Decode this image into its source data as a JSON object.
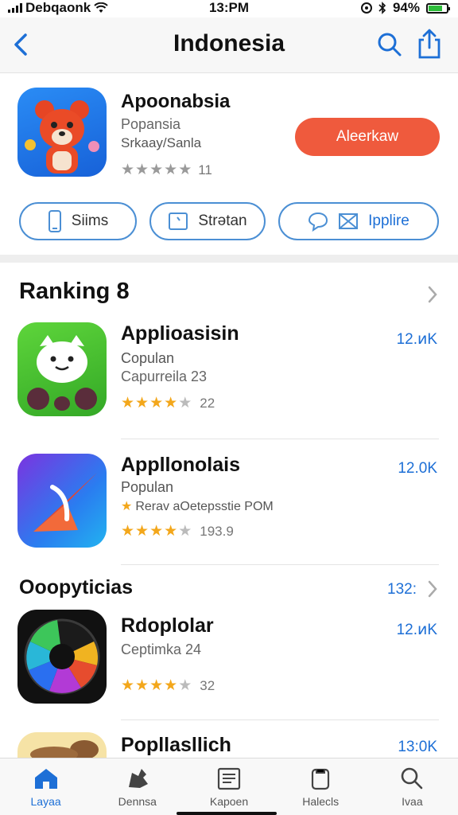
{
  "status_bar": {
    "carrier": "Debqaonk",
    "time": "13:PM",
    "battery": "94%"
  },
  "nav": {
    "title": "Indonesia",
    "back_icon": "chevron-left-icon",
    "search_icon": "search-icon",
    "share_icon": "share-icon"
  },
  "featured": {
    "name": "Apoonabsia",
    "subtitle": "Popansia",
    "meta": "Srkaay/Sanla",
    "rating_count": "11",
    "get_label": "Aleerkaw",
    "actions": [
      {
        "label": "Siims",
        "icon": "phone-icon"
      },
      {
        "label": "Strətan",
        "icon": "screen-icon"
      },
      {
        "label": "Ipplire",
        "icon": "chat-icon"
      }
    ]
  },
  "ranking": {
    "title": "Ranking 8",
    "items": [
      {
        "name": "Applioasisin",
        "line1": "Copulan",
        "line2": "Capurreila 23",
        "rating_count": "22",
        "price": "12.ͷK",
        "rating": 4.5
      },
      {
        "name": "Appllonolais",
        "line1": "Populan",
        "line2": "Rerav aOetepsstie POM",
        "rating_count": "193.9",
        "price": "12.0K",
        "rating": 4.5
      }
    ]
  },
  "popular": {
    "title": "Ooopyticias",
    "see_all": "132:",
    "items": [
      {
        "name": "Rdoplolar",
        "line1": "Ceptimka 24",
        "rating_count": "32",
        "price": "12.ͷK",
        "rating": 4.5
      },
      {
        "name": "Popllasllich",
        "price": "13:0K"
      }
    ]
  },
  "tabbar": {
    "tabs": [
      {
        "label": "Layaa",
        "icon": "home-icon",
        "active": true
      },
      {
        "label": "Dennsa",
        "icon": "games-icon",
        "active": false
      },
      {
        "label": "Kapoen",
        "icon": "news-icon",
        "active": false
      },
      {
        "label": "Halecls",
        "icon": "apps-icon",
        "active": false
      },
      {
        "label": "Ivaa",
        "icon": "search-icon",
        "active": false
      }
    ]
  },
  "colors": {
    "accent": "#1d6fd6",
    "get_button": "#ef5a3d",
    "star": "#f3a71b"
  }
}
